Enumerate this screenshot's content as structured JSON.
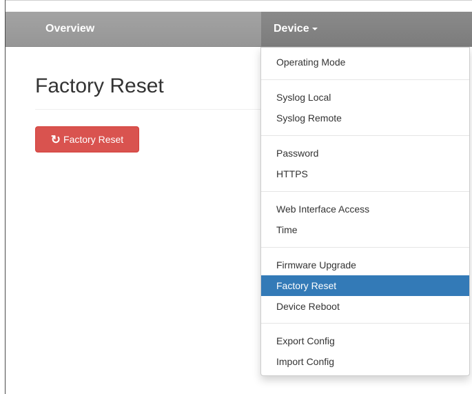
{
  "navbar": {
    "overview_label": "Overview",
    "device_label": "Device"
  },
  "main": {
    "title": "Factory Reset",
    "reset_button_label": "Factory Reset",
    "reset_button_icon": "refresh-icon"
  },
  "dropdown": {
    "items": [
      {
        "label": "Operating Mode"
      },
      {
        "label": "Syslog Local"
      },
      {
        "label": "Syslog Remote"
      },
      {
        "label": "Password"
      },
      {
        "label": "HTTPS"
      },
      {
        "label": "Web Interface Access"
      },
      {
        "label": "Time"
      },
      {
        "label": "Firmware Upgrade"
      },
      {
        "label": "Factory Reset",
        "active": true
      },
      {
        "label": "Device Reboot"
      },
      {
        "label": "Export Config"
      },
      {
        "label": "Import Config"
      }
    ]
  },
  "colors": {
    "navbar": "#969696",
    "navbar_active": "#808080",
    "danger": "#d9534f",
    "active_item": "#337ab7"
  }
}
